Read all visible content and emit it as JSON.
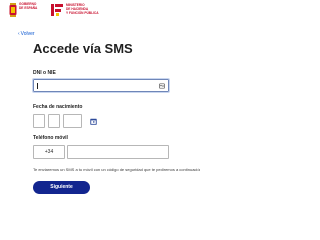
{
  "header": {
    "gov_logo": {
      "line1": "GOBIERNO",
      "line2": "DE ESPAÑA",
      "icon": "coat-of-arms-icon"
    },
    "dept_logo": {
      "line1": "MINISTERIO",
      "line2": "DE HACIENDA",
      "line3": "Y FUNCIÓN PÚBLICA",
      "icon": "agency-logo-icon"
    }
  },
  "back_link": {
    "label": "Volver",
    "icon": "chevron-left-icon"
  },
  "title": "Accede vía SMS",
  "dni": {
    "label": "DNI o NIE",
    "value": "",
    "icon": "id-card-icon"
  },
  "birth_date": {
    "label": "Fecha de nacimiento",
    "day": "",
    "month": "",
    "year": "",
    "icon": "calendar-icon"
  },
  "phone": {
    "label": "Teléfono móvil",
    "prefix": "+34",
    "value": ""
  },
  "helper_text": "Te enviaremos un SMS a tu móvil con un código de seguridad que te pediremos a continuación",
  "submit": {
    "label": "Siguiente"
  },
  "colors": {
    "primary": "#12258f",
    "link": "#0b57d0",
    "brand_red": "#c8102e",
    "focus_border": "#6f86b8"
  }
}
